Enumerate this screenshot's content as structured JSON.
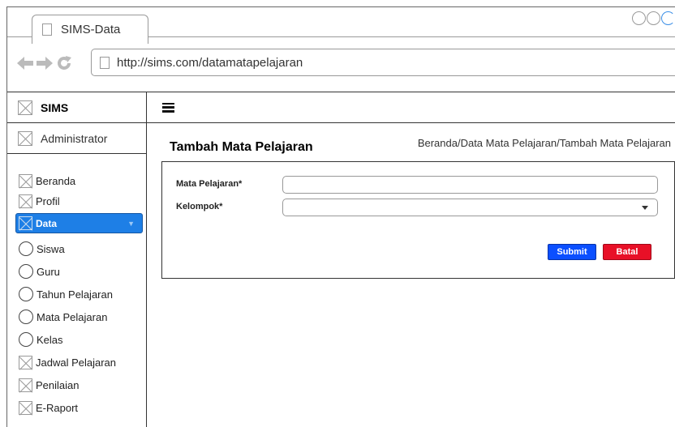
{
  "browser": {
    "tab_title": "SIMS-Data",
    "url": "http://sims.com/datamatapelajaran"
  },
  "sidebar": {
    "brand": "SIMS",
    "user": "Administrator",
    "items": [
      {
        "label": "Beranda",
        "icon": "placeholder-icon"
      },
      {
        "label": "Profil",
        "icon": "placeholder-icon"
      },
      {
        "label": "Data",
        "icon": "placeholder-icon",
        "active": true
      },
      {
        "label": "Siswa",
        "icon": "circle-icon"
      },
      {
        "label": "Guru",
        "icon": "circle-icon"
      },
      {
        "label": "Tahun Pelajaran",
        "icon": "circle-icon"
      },
      {
        "label": "Mata Pelajaran",
        "icon": "circle-icon"
      },
      {
        "label": "Kelas",
        "icon": "circle-icon"
      },
      {
        "label": "Jadwal Pelajaran",
        "icon": "placeholder-icon"
      },
      {
        "label": "Penilaian",
        "icon": "placeholder-icon"
      },
      {
        "label": "E-Raport",
        "icon": "placeholder-icon"
      }
    ]
  },
  "main": {
    "title": "Tambah Mata Pelajaran",
    "breadcrumb": "Beranda/Data Mata Pelajaran/Tambah Mata Pelajaran",
    "form": {
      "mata_pelajaran_label": "Mata Pelajaran*",
      "mata_pelajaran_value": "",
      "kelompok_label": "Kelompok*",
      "kelompok_value": "",
      "submit_label": "Submit",
      "cancel_label": "Batal"
    }
  },
  "colors": {
    "active_menu": "#1e7fe6",
    "submit": "#0b4fff",
    "cancel": "#e81027"
  }
}
